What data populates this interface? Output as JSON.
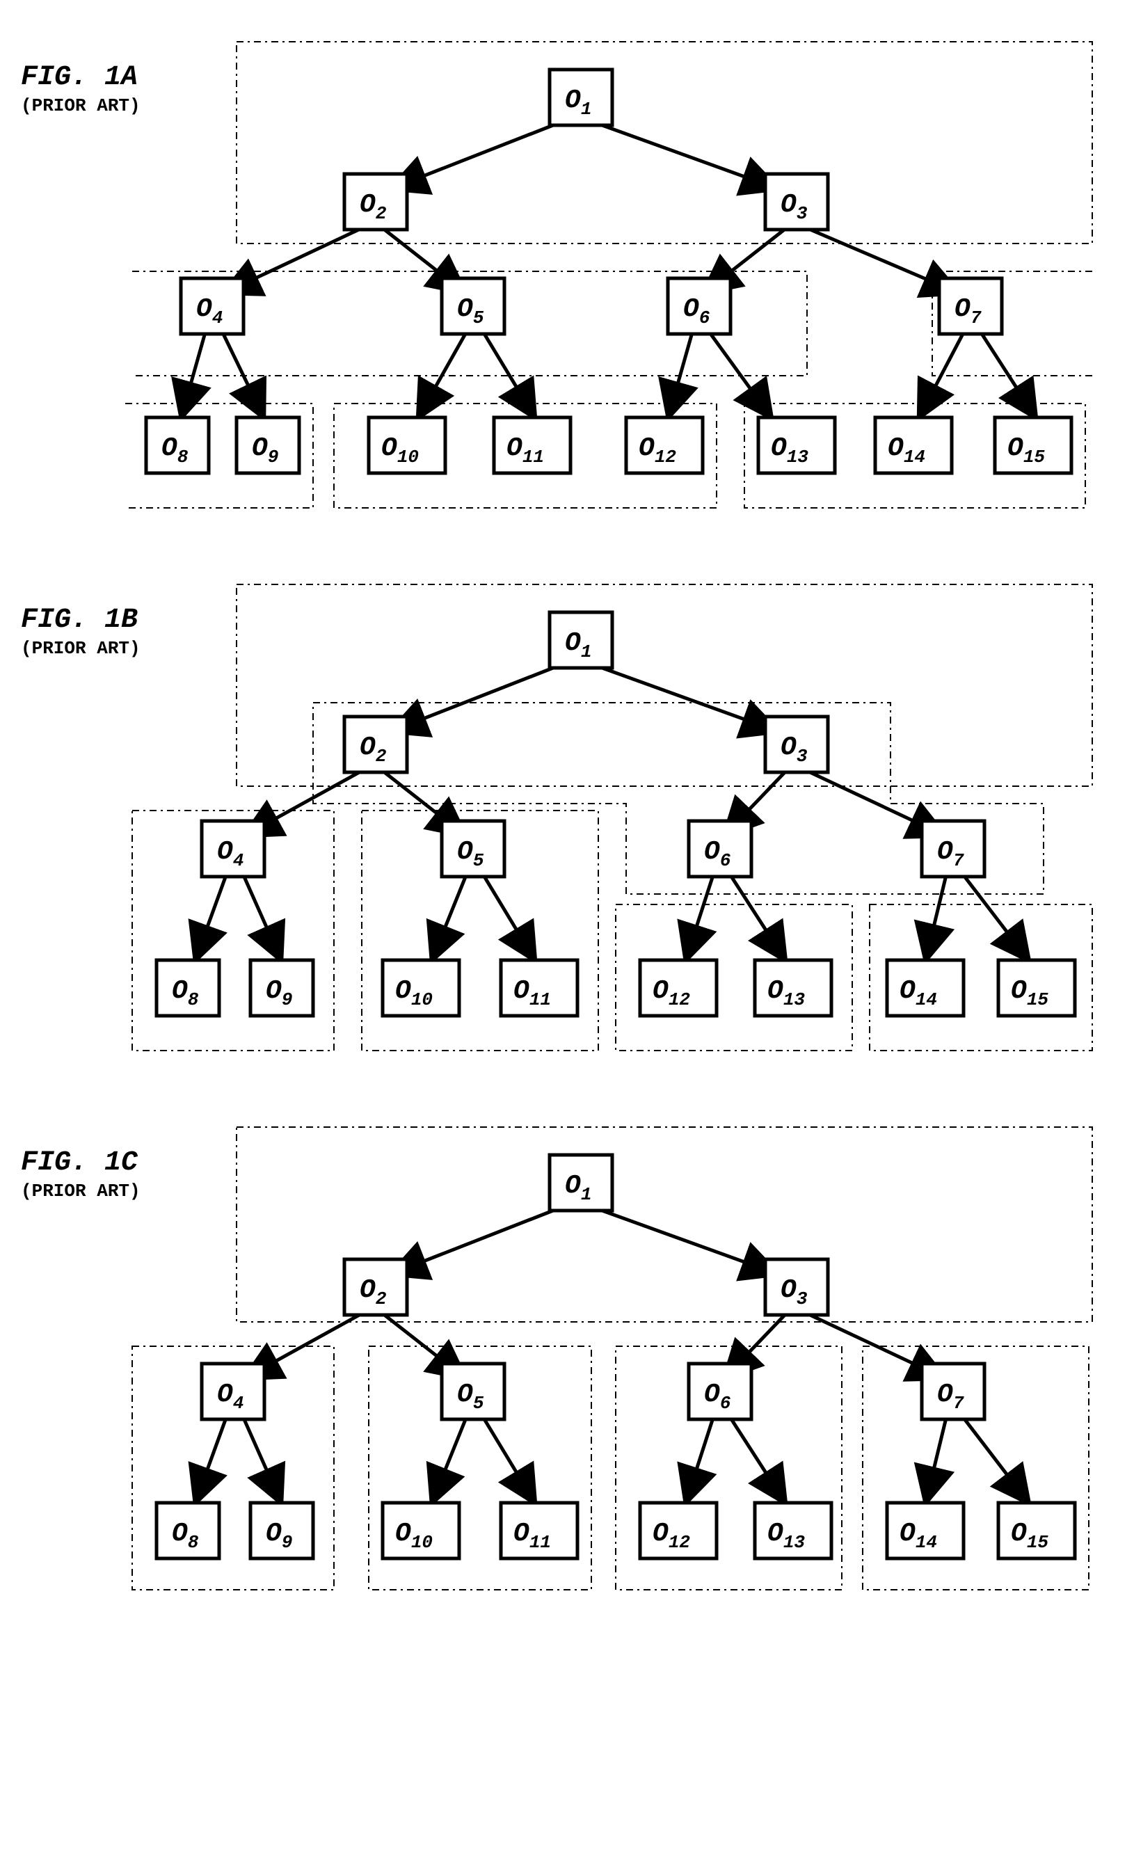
{
  "figures": [
    {
      "title": "FIG. 1A",
      "subtitle": "(PRIOR ART)"
    },
    {
      "title": "FIG. 1B",
      "subtitle": "(PRIOR ART)"
    },
    {
      "title": "FIG. 1C",
      "subtitle": "(PRIOR ART)"
    }
  ],
  "nodeLetter": "O",
  "nodes": [
    1,
    2,
    3,
    4,
    5,
    6,
    7,
    8,
    9,
    10,
    11,
    12,
    13,
    14,
    15
  ],
  "tree": {
    "root": 1,
    "edges": [
      [
        1,
        2
      ],
      [
        1,
        3
      ],
      [
        2,
        4
      ],
      [
        2,
        5
      ],
      [
        3,
        6
      ],
      [
        3,
        7
      ],
      [
        4,
        8
      ],
      [
        4,
        9
      ],
      [
        5,
        10
      ],
      [
        5,
        11
      ],
      [
        6,
        12
      ],
      [
        6,
        13
      ],
      [
        7,
        14
      ],
      [
        7,
        15
      ]
    ]
  },
  "chart_data": {
    "type": "diagram",
    "description": "Three variants (FIG. 1A, 1B, 1C, all PRIOR ART) of the same 15-node binary tree rooted at O1. Each leaf row has O8..O15. The dash-dot grouping boxes differ per figure, illustrating different partitioning/clustering schemes of the nodes onto units.",
    "common_tree_edges": [
      [
        1,
        2
      ],
      [
        1,
        3
      ],
      [
        2,
        4
      ],
      [
        2,
        5
      ],
      [
        3,
        6
      ],
      [
        3,
        7
      ],
      [
        4,
        8
      ],
      [
        4,
        9
      ],
      [
        5,
        10
      ],
      [
        5,
        11
      ],
      [
        6,
        12
      ],
      [
        6,
        13
      ],
      [
        7,
        14
      ],
      [
        7,
        15
      ]
    ],
    "node_labels": [
      "O1",
      "O2",
      "O3",
      "O4",
      "O5",
      "O6",
      "O7",
      "O8",
      "O9",
      "O10",
      "O11",
      "O12",
      "O13",
      "O14",
      "O15"
    ],
    "fig1A_groups": [
      [
        1,
        2,
        3
      ],
      [
        4,
        5,
        6
      ],
      [
        7
      ],
      [
        8,
        9
      ],
      [
        10,
        11,
        12
      ],
      [
        13,
        14,
        15
      ]
    ],
    "fig1B_groups": [
      [
        1,
        2,
        3
      ],
      [
        2,
        3,
        6,
        7
      ],
      [
        4,
        8,
        9
      ],
      [
        5,
        10,
        11
      ],
      [
        6,
        12,
        13
      ],
      [
        7,
        14,
        15
      ]
    ],
    "fig1C_groups": [
      [
        1,
        2,
        3
      ],
      [
        4,
        8,
        9
      ],
      [
        5,
        10,
        11
      ],
      [
        6,
        12,
        13
      ],
      [
        7,
        14,
        15
      ]
    ]
  }
}
